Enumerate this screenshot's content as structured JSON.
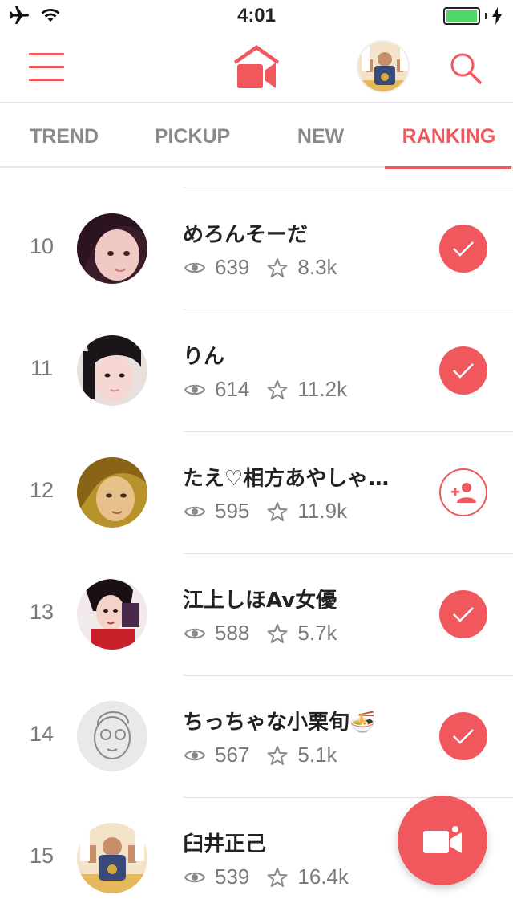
{
  "status_bar": {
    "time": "4:01"
  },
  "colors": {
    "accent": "#f0585e",
    "text_muted": "#7b7b7b",
    "battery": "#4cd964"
  },
  "navbar": {
    "menu_icon": "hamburger-menu-icon",
    "home_icon": "home-video-icon",
    "avatar_icon": "user-avatar",
    "search_icon": "search-icon"
  },
  "tabs": [
    {
      "label": "TREND",
      "active": false
    },
    {
      "label": "PICKUP",
      "active": false
    },
    {
      "label": "NEW",
      "active": false
    },
    {
      "label": "RANKING",
      "active": true
    }
  ],
  "ranking": [
    {
      "rank": "10",
      "name": "めろんそーだ",
      "views": "639",
      "stars": "8.3k",
      "followed": true
    },
    {
      "rank": "11",
      "name": "りん",
      "views": "614",
      "stars": "11.2k",
      "followed": true
    },
    {
      "rank": "12",
      "name": "たえ♡相方あやしゃ…",
      "views": "595",
      "stars": "11.9k",
      "followed": false
    },
    {
      "rank": "13",
      "name": "江上しほAv女優",
      "views": "588",
      "stars": "5.7k",
      "followed": true
    },
    {
      "rank": "14",
      "name": "ちっちゃな小栗旬🍜",
      "views": "567",
      "stars": "5.1k",
      "followed": true
    },
    {
      "rank": "15",
      "name": "臼井正己",
      "views": "539",
      "stars": "16.4k",
      "followed": null
    }
  ],
  "fab": {
    "icon": "video-camera-icon"
  }
}
